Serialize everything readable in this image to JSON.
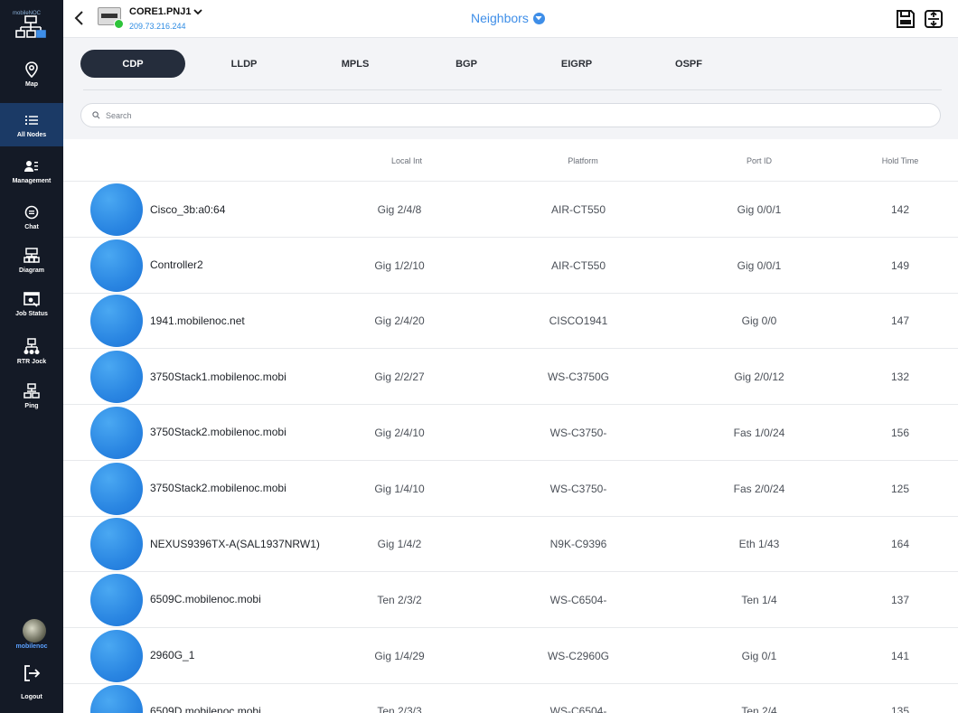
{
  "app": {
    "logo_text": "mobileNOC"
  },
  "sidebar": {
    "items": [
      {
        "label": "Map",
        "icon": "map-pin-icon",
        "active": false
      },
      {
        "label": "All Nodes",
        "icon": "list-icon",
        "active": true
      },
      {
        "label": "Management",
        "icon": "management-icon",
        "active": false
      },
      {
        "label": "Chat",
        "icon": "chat-icon",
        "active": false
      },
      {
        "label": "Diagram",
        "icon": "diagram-icon",
        "active": false
      },
      {
        "label": "Job Status",
        "icon": "job-status-icon",
        "active": false
      },
      {
        "label": "RTR Jock",
        "icon": "rtr-jock-icon",
        "active": false
      },
      {
        "label": "Ping",
        "icon": "ping-icon",
        "active": false
      }
    ],
    "user": {
      "name": "mobilenoc"
    },
    "logout_label": "Logout"
  },
  "header": {
    "device_name": "CORE1.PNJ1",
    "device_ip": "209.73.216.244",
    "title": "Neighbors",
    "accent_color": "#3e8ee8"
  },
  "tabs": [
    "CDP",
    "LLDP",
    "MPLS",
    "BGP",
    "EIGRP",
    "OSPF"
  ],
  "active_tab": "CDP",
  "search": {
    "placeholder": "Search"
  },
  "table": {
    "columns": [
      "Local Int",
      "Platform",
      "Port ID",
      "Hold Time"
    ],
    "rows": [
      {
        "name": "Cisco_3b:a0:64",
        "local_int": "Gig 2/4/8",
        "platform": "AIR-CT550",
        "port_id": "Gig 0/0/1",
        "hold_time": "142"
      },
      {
        "name": "Controller2",
        "local_int": "Gig 1/2/10",
        "platform": "AIR-CT550",
        "port_id": "Gig 0/0/1",
        "hold_time": "149"
      },
      {
        "name": "1941.mobilenoc.net",
        "local_int": "Gig 2/4/20",
        "platform": "CISCO1941",
        "port_id": "Gig 0/0",
        "hold_time": "147"
      },
      {
        "name": "3750Stack1.mobilenoc.mobi",
        "local_int": "Gig 2/2/27",
        "platform": "WS-C3750G",
        "port_id": "Gig 2/0/12",
        "hold_time": "132"
      },
      {
        "name": "3750Stack2.mobilenoc.mobi",
        "local_int": "Gig 2/4/10",
        "platform": "WS-C3750-",
        "port_id": "Fas 1/0/24",
        "hold_time": "156"
      },
      {
        "name": "3750Stack2.mobilenoc.mobi",
        "local_int": "Gig 1/4/10",
        "platform": "WS-C3750-",
        "port_id": "Fas 2/0/24",
        "hold_time": "125"
      },
      {
        "name": "NEXUS9396TX-A(SAL1937NRW1)",
        "local_int": "Gig 1/4/2",
        "platform": "N9K-C9396",
        "port_id": "Eth 1/43",
        "hold_time": "164"
      },
      {
        "name": "6509C.mobilenoc.mobi",
        "local_int": "Ten 2/3/2",
        "platform": "WS-C6504-",
        "port_id": "Ten 1/4",
        "hold_time": "137"
      },
      {
        "name": "2960G_1",
        "local_int": "Gig 1/4/29",
        "platform": "WS-C2960G",
        "port_id": "Gig 0/1",
        "hold_time": "141"
      },
      {
        "name": "6509D.mobilenoc.mobi",
        "local_int": "Ten 2/3/3",
        "platform": "WS-C6504-",
        "port_id": "Ten 2/4",
        "hold_time": "135"
      }
    ]
  }
}
